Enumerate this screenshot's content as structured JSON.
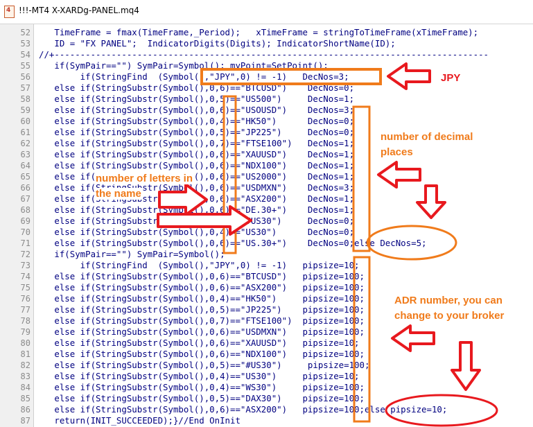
{
  "window": {
    "title": "!!!-MT4 X-XARDg-PANEL.mq4"
  },
  "icons": {
    "file": "mq4-file-icon",
    "file_glyph": "4"
  },
  "colors": {
    "code": "#000080",
    "accent": "#f07b1b",
    "arrow": "#e8191e"
  },
  "editor": {
    "lines": [
      {
        "num": "52",
        "text": "   TimeFrame = fmax(TimeFrame,_Period);   xTimeFrame = stringToTimeFrame(xTimeFrame);"
      },
      {
        "num": "53",
        "text": "   ID = \"FX PANEL\";  IndicatorDigits(Digits); IndicatorShortName(ID);"
      },
      {
        "num": "54",
        "text": "//+------------------------------------------------------------------------------------"
      },
      {
        "num": "55",
        "text": "   if(SymPair==\"\") SymPair=Symbol(); myPoint=SetPoint();"
      },
      {
        "num": "56",
        "text": "        if(StringFind  (Symbol(),\"JPY\",0) != -1)   DecNos=3;"
      },
      {
        "num": "57",
        "text": "   else if(StringSubstr(Symbol(),0,6)==\"BTCUSD\")    DecNos=0;"
      },
      {
        "num": "58",
        "text": "   else if(StringSubstr(Symbol(),0,5)==\"US500\")     DecNos=1;"
      },
      {
        "num": "59",
        "text": "   else if(StringSubstr(Symbol(),0,6)==\"USOUSD\")    DecNos=3;"
      },
      {
        "num": "60",
        "text": "   else if(StringSubstr(Symbol(),0,4)==\"HK50\")      DecNos=0;"
      },
      {
        "num": "61",
        "text": "   else if(StringSubstr(Symbol(),0,5)==\"JP225\")     DecNos=0;"
      },
      {
        "num": "62",
        "text": "   else if(StringSubstr(Symbol(),0,7)==\"FTSE100\")   DecNos=1;"
      },
      {
        "num": "63",
        "text": "   else if(StringSubstr(Symbol(),0,6)==\"XAUUSD\")    DecNos=1;"
      },
      {
        "num": "64",
        "text": "   else if(StringSubstr(Symbol(),0,6)==\"NDX100\")    DecNos=1;"
      },
      {
        "num": "65",
        "text": "   else if(StringSubstr(Symbol(),0,6)==\"US2000\")    DecNos=1;"
      },
      {
        "num": "66",
        "text": "   else if(StringSubstr(Symbol(),0,6)==\"USDMXN\")    DecNos=3;"
      },
      {
        "num": "67",
        "text": "   else if(StringSubstr(Symbol(),0,6)==\"ASX200\")    DecNos=1;"
      },
      {
        "num": "68",
        "text": "   else if(StringSubstr(Symbol(),0,6)==\"DE.30+\")    DecNos=1;"
      },
      {
        "num": "69",
        "text": "   else if(StringSubstr(Symbol(),0,5)==\"#US30\")     DecNos=0;"
      },
      {
        "num": "70",
        "text": "   else if(StringSubstr(Symbol(),0,4)==\"US30\")      DecNos=0;"
      },
      {
        "num": "71",
        "text": "   else if(StringSubstr(Symbol(),0,6)==\"US.30+\")    DecNos=0;else DecNos=5;"
      },
      {
        "num": "72",
        "text": "   if(SymPair==\"\") SymPair=Symbol();"
      },
      {
        "num": "73",
        "text": "        if(StringFind  (Symbol(),\"JPY\",0) != -1)   pipsize=10;"
      },
      {
        "num": "74",
        "text": "   else if(StringSubstr(Symbol(),0,6)==\"BTCUSD\")   pipsize=100;"
      },
      {
        "num": "75",
        "text": "   else if(StringSubstr(Symbol(),0,6)==\"ASX200\")   pipsize=100;"
      },
      {
        "num": "76",
        "text": "   else if(StringSubstr(Symbol(),0,4)==\"HK50\")     pipsize=100;"
      },
      {
        "num": "77",
        "text": "   else if(StringSubstr(Symbol(),0,5)==\"JP225\")    pipsize=100;"
      },
      {
        "num": "78",
        "text": "   else if(StringSubstr(Symbol(),0,7)==\"FTSE100\")  pipsize=100;"
      },
      {
        "num": "79",
        "text": "   else if(StringSubstr(Symbol(),0,6)==\"USDMXN\")   pipsize=100;"
      },
      {
        "num": "80",
        "text": "   else if(StringSubstr(Symbol(),0,6)==\"XAUUSD\")   pipsize=10;"
      },
      {
        "num": "81",
        "text": "   else if(StringSubstr(Symbol(),0,6)==\"NDX100\")   pipsize=100;"
      },
      {
        "num": "82",
        "text": "   else if(StringSubstr(Symbol(),0,5)==\"#US30\")     pipsize=100;"
      },
      {
        "num": "83",
        "text": "   else if(StringSubstr(Symbol(),0,4)==\"US30\")     pipsize=10;"
      },
      {
        "num": "84",
        "text": "   else if(StringSubstr(Symbol(),0,4)==\"WS30\")     pipsize=100;"
      },
      {
        "num": "85",
        "text": "   else if(StringSubstr(Symbol(),0,5)==\"DAX30\")    pipsize=100;"
      },
      {
        "num": "86",
        "text": "   else if(StringSubstr(Symbol(),0,6)==\"ASX200\")   pipsize=100;else pipsize=10;"
      },
      {
        "num": "87",
        "text": "   return(INIT_SUCCEEDED);}//End OnInit"
      }
    ]
  },
  "annotations": {
    "jpy": "JPY",
    "decimal_line1": "number of decimal",
    "decimal_line2": "places",
    "letters_line1": "number of letters in",
    "letters_line2": "the name",
    "adr_line1": "ADR number, you can",
    "adr_line2": "change to your broker"
  }
}
